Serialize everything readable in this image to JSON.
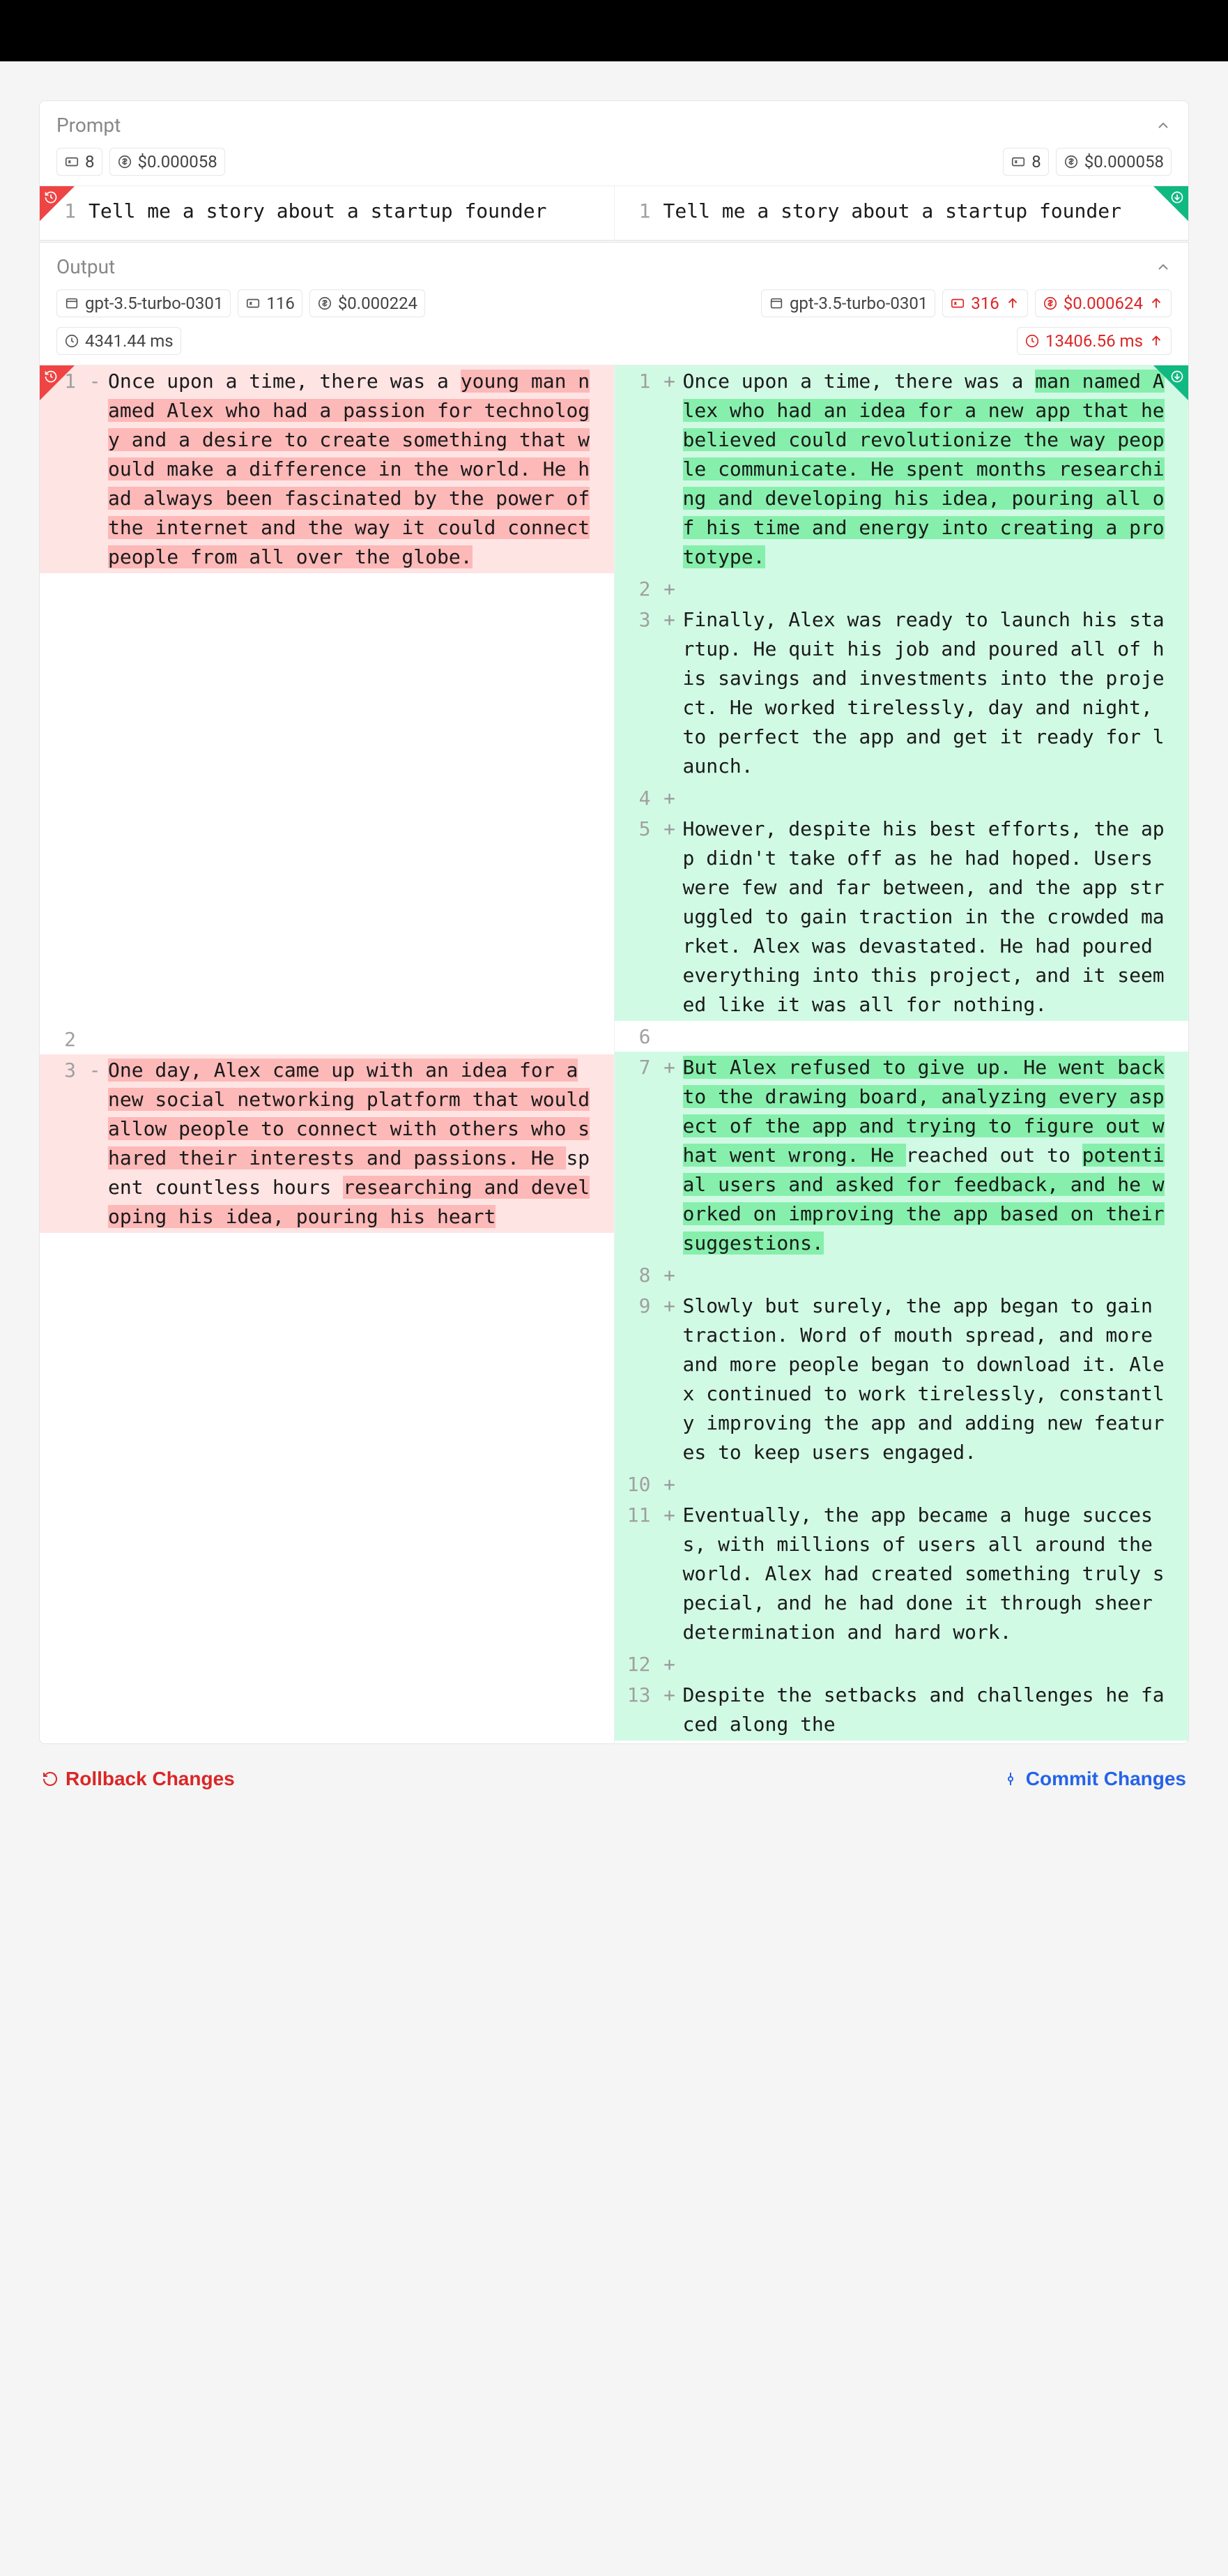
{
  "sections": {
    "prompt": {
      "title": "Prompt",
      "left": {
        "tokens": "8",
        "cost": "$0.000058",
        "line_no": "1",
        "text": "Tell me a story about a startup founder"
      },
      "right": {
        "tokens": "8",
        "cost": "$0.000058",
        "line_no": "1",
        "text": "Tell me a story about a startup founder"
      }
    },
    "output": {
      "title": "Output",
      "left_meta": {
        "model": "gpt-3.5-turbo-0301",
        "tokens": "116",
        "cost": "$0.000224",
        "latency": "4341.44 ms"
      },
      "right_meta": {
        "model": "gpt-3.5-turbo-0301",
        "tokens": "316",
        "cost": "$0.000624",
        "latency": "13406.56 ms"
      }
    }
  },
  "diff": {
    "left": [
      {
        "n": "1",
        "m": "-",
        "kind": "del",
        "plain": "Once upon a time, there was a ",
        "hl": "young man named Alex who had a passion for technology and a desire to create something that would make a difference in the world. He had always been fascinated by the power of the internet and the way it could connect people from all over the globe."
      },
      {
        "n": "2",
        "m": "",
        "kind": "ctx",
        "text": ""
      },
      {
        "n": "3",
        "m": "-",
        "kind": "del",
        "plain": "",
        "hl": "One day, Alex came up with an idea for a new social networking platform that would allow people to connect with others who shared their interests and passions. He ",
        "plain2": "spent countless hours ",
        "hl2": "researching and developing his idea, pouring his heart"
      }
    ],
    "right": [
      {
        "n": "1",
        "m": "+",
        "kind": "add",
        "plain": "Once upon a time, there was a ",
        "hl": "man named Alex who had an idea for a new app that he believed could revolutionize the way people communicate. He spent months researching and developing his idea, pouring all of his time and energy into creating a prototype."
      },
      {
        "n": "2",
        "m": "+",
        "kind": "add",
        "text": ""
      },
      {
        "n": "3",
        "m": "+",
        "kind": "add",
        "text": "Finally, Alex was ready to launch his startup. He quit his job and poured all of his savings and investments into the project. He worked tirelessly, day and night, to perfect the app and get it ready for launch."
      },
      {
        "n": "4",
        "m": "+",
        "kind": "add",
        "text": ""
      },
      {
        "n": "5",
        "m": "+",
        "kind": "add",
        "text": "However, despite his best efforts, the app didn't take off as he had hoped. Users were few and far between, and the app struggled to gain traction in the crowded market. Alex was devastated. He had poured everything into this project, and it seemed like it was all for nothing."
      },
      {
        "n": "6",
        "m": "",
        "kind": "ctx",
        "text": ""
      },
      {
        "n": "7",
        "m": "+",
        "kind": "add",
        "plain": "",
        "hl": "But Alex refused to give up. He went back to the drawing board, analyzing every aspect of the app and trying to figure out what went wrong. He ",
        "plain2": "reached out to ",
        "hl2": "potential users and asked for feedback, and he worked on improving the app based on their suggestions."
      },
      {
        "n": "8",
        "m": "+",
        "kind": "add",
        "text": ""
      },
      {
        "n": "9",
        "m": "+",
        "kind": "add",
        "text": "Slowly but surely, the app began to gain traction. Word of mouth spread, and more and more people began to download it. Alex continued to work tirelessly, constantly improving the app and adding new features to keep users engaged."
      },
      {
        "n": "10",
        "m": "+",
        "kind": "add",
        "text": ""
      },
      {
        "n": "11",
        "m": "+",
        "kind": "add",
        "text": "Eventually, the app became a huge success, with millions of users all around the world. Alex had created something truly special, and he had done it through sheer determination and hard work."
      },
      {
        "n": "12",
        "m": "+",
        "kind": "add",
        "text": ""
      },
      {
        "n": "13",
        "m": "+",
        "kind": "add",
        "text": "Despite the setbacks and challenges he faced along the"
      }
    ]
  },
  "actions": {
    "rollback": "Rollback Changes",
    "commit": "Commit Changes"
  }
}
